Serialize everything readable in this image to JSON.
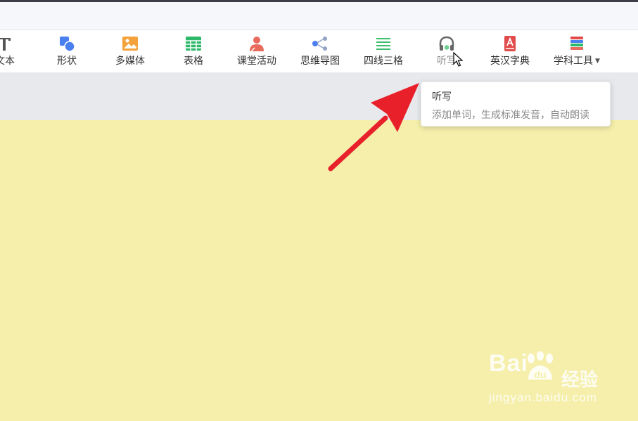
{
  "toolbar": {
    "items": [
      {
        "label": "文本",
        "icon": "text-icon"
      },
      {
        "label": "形状",
        "icon": "shape-icon"
      },
      {
        "label": "多媒体",
        "icon": "multimedia-icon"
      },
      {
        "label": "表格",
        "icon": "table-icon"
      },
      {
        "label": "课堂活动",
        "icon": "classroom-activity-icon"
      },
      {
        "label": "思维导图",
        "icon": "mind-map-icon"
      },
      {
        "label": "四线三格",
        "icon": "four-line-grid-icon"
      },
      {
        "label": "听写",
        "icon": "headphones-icon"
      },
      {
        "label": "英汉字典",
        "icon": "dictionary-icon"
      },
      {
        "label": "学科工具",
        "icon": "subject-tools-icon"
      }
    ]
  },
  "tooltip": {
    "title": "听写",
    "description": "添加单词，生成标准发音，自动朗读"
  },
  "watermark": {
    "brand": "Baidu",
    "chinese": "经验",
    "url": "jingyan.baidu.com"
  },
  "colors": {
    "canvas": "#f5efab",
    "arrow": "#e8202a",
    "shape_blue": "#4a7ff0",
    "multimedia_orange": "#f4a23c",
    "table_green": "#2eb86a",
    "activity_red": "#e96b5d",
    "dictionary_red": "#e24b4b"
  }
}
